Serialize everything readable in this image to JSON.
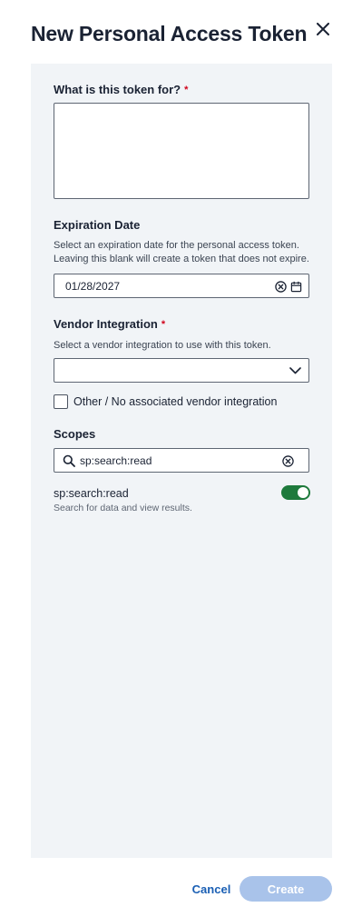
{
  "dialog": {
    "title": "New Personal Access Token"
  },
  "form": {
    "purpose": {
      "label": "What is this token for?",
      "required_mark": "*",
      "value": ""
    },
    "expiration": {
      "label": "Expiration Date",
      "help_line1": "Select an expiration date for the personal access token.",
      "help_line2": "Leaving this blank will create a token that does not expire.",
      "value": "01/28/2027"
    },
    "vendor": {
      "label": "Vendor Integration",
      "required_mark": "*",
      "help": "Select a vendor integration to use with this token.",
      "selected": "",
      "no_vendor_label": "Other / No associated vendor integration",
      "no_vendor_checked": false
    },
    "scopes": {
      "label": "Scopes",
      "search_value": "sp:search:read",
      "items": [
        {
          "name": "sp:search:read",
          "description": "Search for data and view results.",
          "enabled": true
        }
      ]
    }
  },
  "footer": {
    "cancel_label": "Cancel",
    "create_label": "Create"
  },
  "colors": {
    "panel_bg": "#f1f4f7",
    "required": "#d0021b",
    "toggle_on": "#1e7a3c",
    "link": "#1a5fb4",
    "primary_disabled": "#a9c3ea"
  },
  "icons": {
    "close": "close-icon",
    "clear": "clear-circle-icon",
    "calendar": "calendar-icon",
    "chevron": "chevron-down-icon",
    "search": "search-icon"
  }
}
